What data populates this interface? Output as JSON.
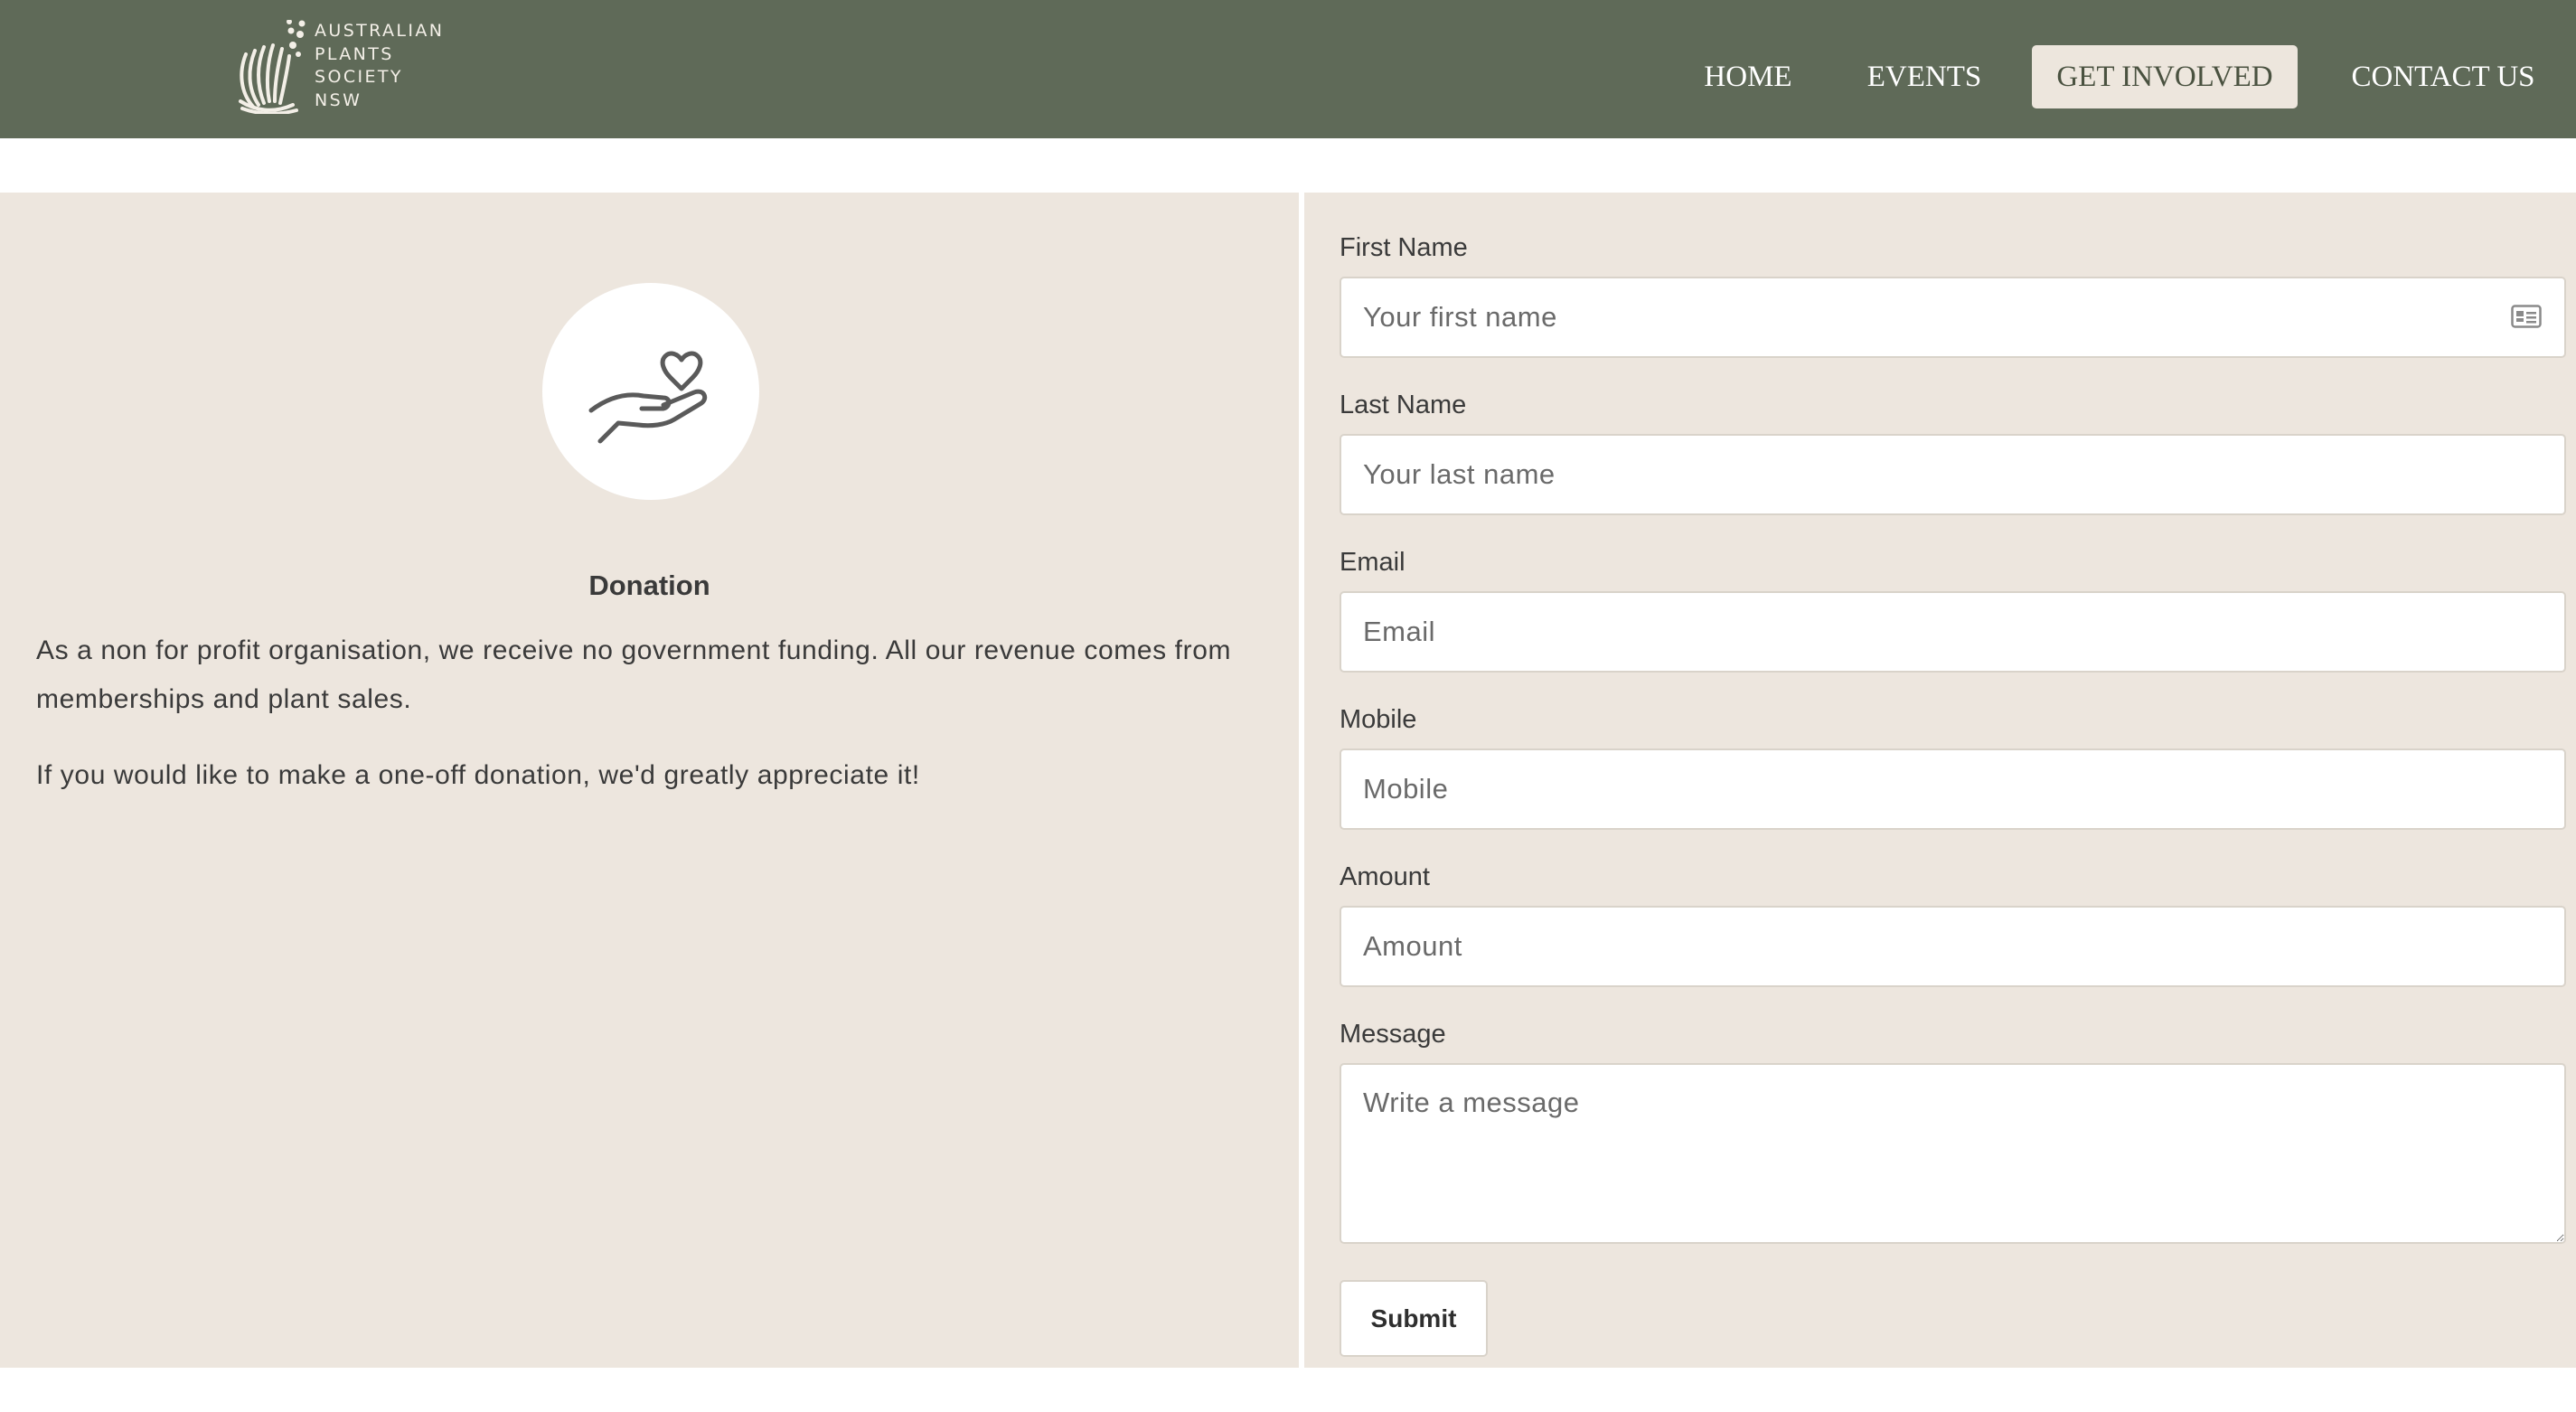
{
  "header": {
    "logo": {
      "lines": [
        "AUSTRALIAN",
        "PLANTS",
        "SOCIETY",
        "NSW"
      ],
      "icon": "waratah-logo-icon"
    },
    "nav": [
      {
        "label": "HOME",
        "active": false
      },
      {
        "label": "EVENTS",
        "active": false
      },
      {
        "label": "GET INVOLVED",
        "active": true
      },
      {
        "label": "CONTACT US",
        "active": false
      }
    ]
  },
  "donation": {
    "icon": "hand-heart-icon",
    "title": "Donation",
    "paragraphs": [
      "As a non for profit organisation, we receive no government funding. All our revenue comes from memberships and plant sales.",
      "If you would like to make a one-off donation, we'd greatly appreciate it!"
    ]
  },
  "form": {
    "first_name": {
      "label": "First Name",
      "placeholder": "Your first name",
      "value": "",
      "icon": "contact-card-icon"
    },
    "last_name": {
      "label": "Last Name",
      "placeholder": "Your last name",
      "value": ""
    },
    "email": {
      "label": "Email",
      "placeholder": "Email",
      "value": ""
    },
    "mobile": {
      "label": "Mobile",
      "placeholder": "Mobile",
      "value": ""
    },
    "amount": {
      "label": "Amount",
      "placeholder": "Amount",
      "value": ""
    },
    "message": {
      "label": "Message",
      "placeholder": "Write a message",
      "value": ""
    },
    "submit_label": "Submit"
  },
  "colors": {
    "header_bg": "#5f6a58",
    "panel_bg": "#ede6de",
    "active_nav_bg": "#ede6dd"
  }
}
